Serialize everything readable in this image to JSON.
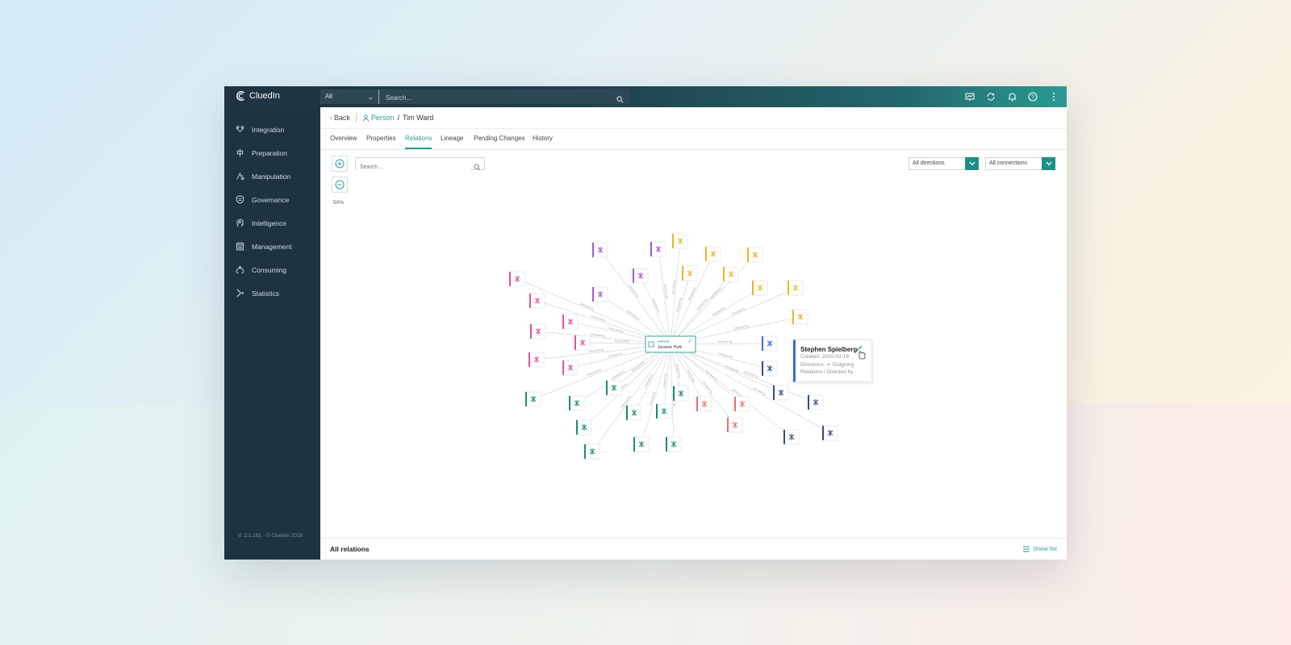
{
  "app": {
    "name": "CluedIn",
    "version": "V. 2.1.191 - © CluedIn 2018"
  },
  "topbar": {
    "scope_value": "All",
    "search_placeholder": "Search...",
    "icons": [
      "dashboard-icon",
      "sync-icon",
      "bell-icon",
      "help-icon",
      "more-vertical-icon"
    ]
  },
  "sidebar": {
    "items": [
      {
        "label": "Integration",
        "icon": "integration-icon"
      },
      {
        "label": "Preparation",
        "icon": "preparation-icon"
      },
      {
        "label": "Manipulation",
        "icon": "manipulation-icon"
      },
      {
        "label": "Governance",
        "icon": "shield-icon"
      },
      {
        "label": "Intelligence",
        "icon": "brain-icon"
      },
      {
        "label": "Management",
        "icon": "calendar-icon"
      },
      {
        "label": "Consuming",
        "icon": "consuming-icon"
      },
      {
        "label": "Statistics",
        "icon": "statistics-icon"
      }
    ]
  },
  "breadcrumb": {
    "back": "Back",
    "entity_type": "Person",
    "separator": "/",
    "entity_name": "Tim Ward"
  },
  "tabs": [
    "Overview",
    "Properties",
    "Relations",
    "Lineage",
    "Pending Changes",
    "History"
  ],
  "active_tab": "Relations",
  "graph_toolbar": {
    "zoom_level": "50%",
    "search_placeholder": "Search...",
    "direction_filter": "All directions",
    "connection_filter": "All connections"
  },
  "graph": {
    "center": {
      "type": "Movie",
      "name": "Jurassic Park"
    },
    "edge_label": "Directed by",
    "colors": {
      "purple": "#a857d6",
      "yellow": "#f0b323",
      "pink": "#e0529c",
      "teal": "#1f8a70",
      "salmon": "#ef6b6b",
      "navy": "#2f4b8a",
      "blue": "#3f6ad8"
    }
  },
  "tooltip": {
    "name": "Stephen Spielberg",
    "created": "Created: 2020-02-18",
    "directions": "Directions: ⇐ Outgoing",
    "relations": "Relations / Directed by"
  },
  "bottombar": {
    "title": "All relations",
    "show_list": "Show list"
  }
}
